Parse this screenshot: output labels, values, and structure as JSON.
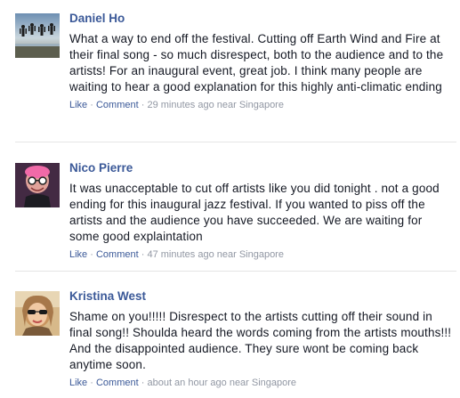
{
  "comments": [
    {
      "author": "Daniel Ho",
      "text": "What a way to end off the festival. Cutting off Earth Wind and Fire at their final song - so much disrespect, both to the audience and to the artists! For an inaugural event, great job. I think many people are waiting to hear a good explanation for this highly anti-climatic ending",
      "like_label": "Like",
      "comment_label": "Comment",
      "sep": "·",
      "time": "29 minutes ago near Singapore"
    },
    {
      "author": "Nico Pierre",
      "text": "It was unacceptable to cut off artists like you did tonight . not a good ending for this inaugural jazz festival. If you wanted to piss off the artists and the audience you have succeeded. We are waiting for some good explaintation",
      "like_label": "Like",
      "comment_label": "Comment",
      "sep": "·",
      "time": "47 minutes ago near Singapore"
    },
    {
      "author": "Kristina West",
      "text": "Shame on you!!!!! Disrespect to the artists cutting off their sound in final song!! Shoulda heard the words coming from the artists mouths!!! And the disappointed audience. They sure wont be coming back anytime soon.",
      "like_label": "Like",
      "comment_label": "Comment",
      "sep": "·",
      "time": "about an hour ago near Singapore"
    }
  ],
  "colors": {
    "link": "#3b5998",
    "meta": "#9197a3",
    "text": "#141823",
    "divider": "#e5e5e5"
  }
}
